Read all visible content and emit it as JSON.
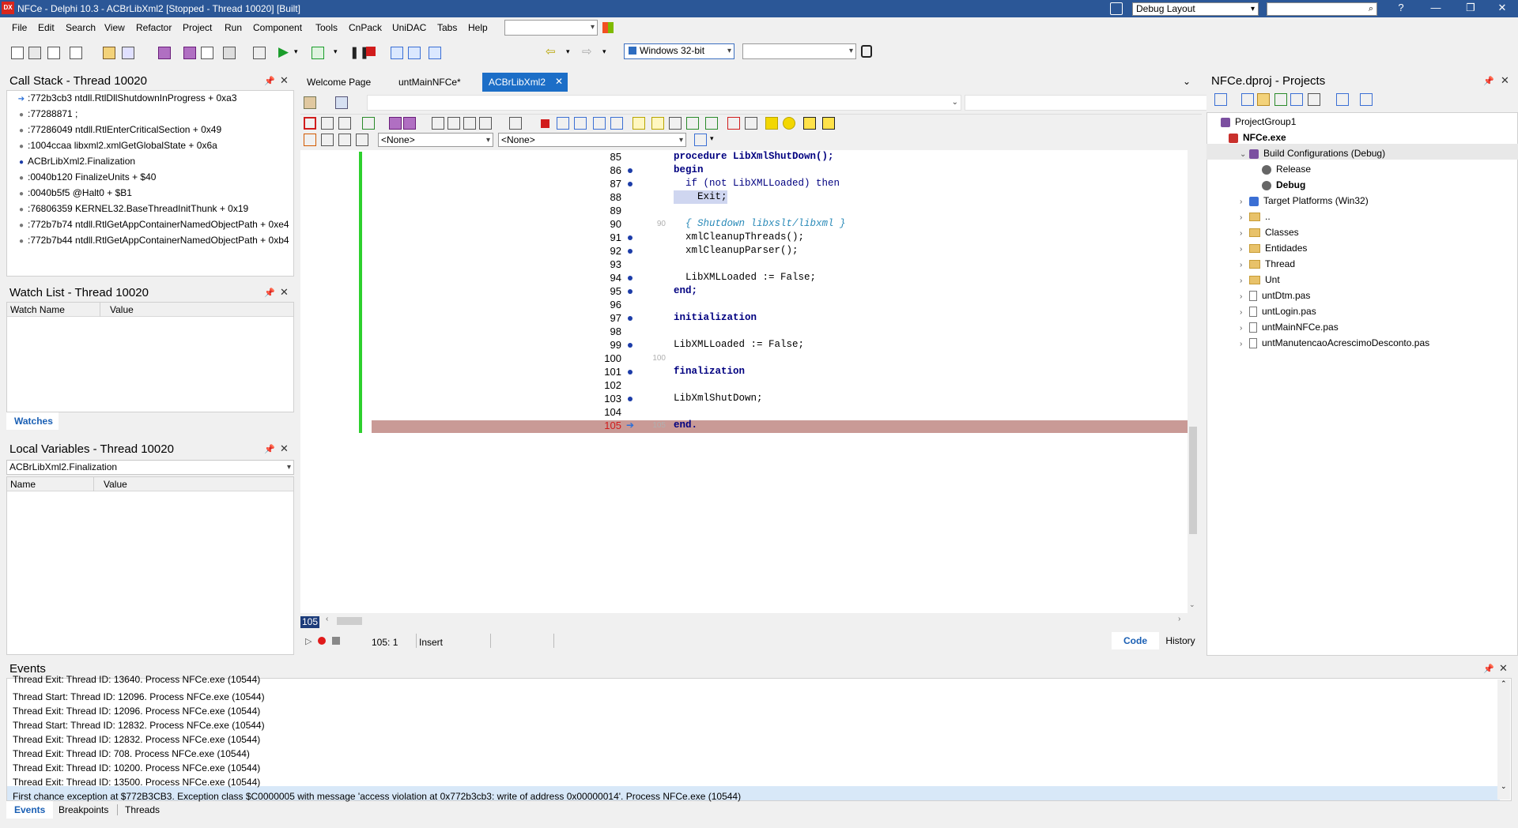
{
  "window": {
    "title": "NFCe - Delphi 10.3 - ACBrLibXml2 [Stopped - Thread 10020] [Built]",
    "logo_text": "DX",
    "layout_select": "Debug Layout",
    "search_placeholder": "",
    "help": "?"
  },
  "menu": [
    "File",
    "Edit",
    "Search",
    "View",
    "Refactor",
    "Project",
    "Run",
    "Component",
    "Tools",
    "CnPack",
    "UniDAC",
    "Tabs",
    "Help"
  ],
  "toolbar": {
    "platform_select": "Windows 32-bit",
    "config_select": ""
  },
  "call_stack": {
    "title": "Call Stack - Thread 10020",
    "rows": [
      ":772b3cb3 ntdll.RtlDllShutdownInProgress + 0xa3",
      ":77288871 ;",
      ":77286049 ntdll.RtlEnterCriticalSection + 0x49",
      ":1004ccaa libxml2.xmlGetGlobalState + 0x6a",
      "ACBrLibXml2.Finalization",
      ":0040b120 FinalizeUnits + $40",
      ":0040b5f5 @Halt0 + $B1",
      ":76806359 KERNEL32.BaseThreadInitThunk + 0x19",
      ":772b7b74 ntdll.RtlGetAppContainerNamedObjectPath + 0xe4",
      ":772b7b44 ntdll.RtlGetAppContainerNamedObjectPath + 0xb4"
    ]
  },
  "watch_list": {
    "title": "Watch List - Thread 10020",
    "col_name": "Watch Name",
    "col_value": "Value",
    "tab": "Watches"
  },
  "local_vars": {
    "title": "Local Variables - Thread 10020",
    "selected": "ACBrLibXml2.Finalization",
    "col_name": "Name",
    "col_value": "Value"
  },
  "editor": {
    "tabs": [
      "Welcome Page",
      "untMainNFCe*",
      "ACBrLibXml2"
    ],
    "none1": "<None>",
    "none2": "<None>",
    "lines": [
      {
        "n": "85",
        "code": "procedure LibXmlShutDown();"
      },
      {
        "n": "86",
        "code": "begin"
      },
      {
        "n": "87",
        "code": "  if (not LibXMLLoaded) then"
      },
      {
        "n": "88",
        "code": "    Exit;"
      },
      {
        "n": "89",
        "code": ""
      },
      {
        "n": "90",
        "code": "  { Shutdown libxslt/libxml }"
      },
      {
        "n": "91",
        "code": "  xmlCleanupThreads();"
      },
      {
        "n": "92",
        "code": "  xmlCleanupParser();"
      },
      {
        "n": "93",
        "code": ""
      },
      {
        "n": "94",
        "code": "  LibXMLLoaded := False;"
      },
      {
        "n": "95",
        "code": "end;"
      },
      {
        "n": "96",
        "code": ""
      },
      {
        "n": "97",
        "code": "initialization"
      },
      {
        "n": "98",
        "code": ""
      },
      {
        "n": "99",
        "code": "LibXMLLoaded := False;"
      },
      {
        "n": "100",
        "code": ""
      },
      {
        "n": "101",
        "code": "finalization"
      },
      {
        "n": "102",
        "code": ""
      },
      {
        "n": "103",
        "code": "LibXmlShutDown;"
      },
      {
        "n": "104",
        "code": ""
      },
      {
        "n": "105",
        "code": "end."
      }
    ],
    "gutter_marks": {
      "90": "90",
      "100": "100",
      "105": "105"
    },
    "current_line_badge": "105",
    "position": "105:  1",
    "mode": "Insert",
    "view_code": "Code",
    "view_history": "History"
  },
  "projects": {
    "title": "NFCe.dproj - Projects",
    "items": [
      {
        "label": "ProjectGroup1",
        "bold": false
      },
      {
        "label": "NFCe.exe",
        "bold": true
      },
      {
        "label": "Build Configurations (Debug)",
        "bold": false
      },
      {
        "label": "Release",
        "bold": false
      },
      {
        "label": "Debug",
        "bold": true
      },
      {
        "label": "Target Platforms (Win32)",
        "bold": false
      },
      {
        "label": "..",
        "bold": false
      },
      {
        "label": "Classes",
        "bold": false
      },
      {
        "label": "Entidades",
        "bold": false
      },
      {
        "label": "Thread",
        "bold": false
      },
      {
        "label": "Unt",
        "bold": false
      },
      {
        "label": "untDtm.pas",
        "bold": false
      },
      {
        "label": "untLogin.pas",
        "bold": false
      },
      {
        "label": "untMainNFCe.pas",
        "bold": false
      },
      {
        "label": "untManutencaoAcrescimoDesconto.pas",
        "bold": false
      }
    ]
  },
  "events": {
    "title": "Events",
    "rows": [
      "Thread Exit: Thread ID: 13640. Process NFCe.exe (10544)",
      "Thread Start: Thread ID: 12096. Process NFCe.exe (10544)",
      "Thread Exit: Thread ID: 12096. Process NFCe.exe (10544)",
      "Thread Start: Thread ID: 12832. Process NFCe.exe (10544)",
      "Thread Exit: Thread ID: 12832. Process NFCe.exe (10544)",
      "Thread Exit: Thread ID: 708. Process NFCe.exe (10544)",
      "Thread Exit: Thread ID: 10200. Process NFCe.exe (10544)",
      "Thread Exit: Thread ID: 13500. Process NFCe.exe (10544)",
      "First chance exception at $772B3CB3. Exception class $C0000005 with message 'access violation at 0x772b3cb3: write of address 0x00000014'. Process NFCe.exe (10544)"
    ],
    "tabs": [
      "Events",
      "Breakpoints",
      "Threads"
    ]
  }
}
